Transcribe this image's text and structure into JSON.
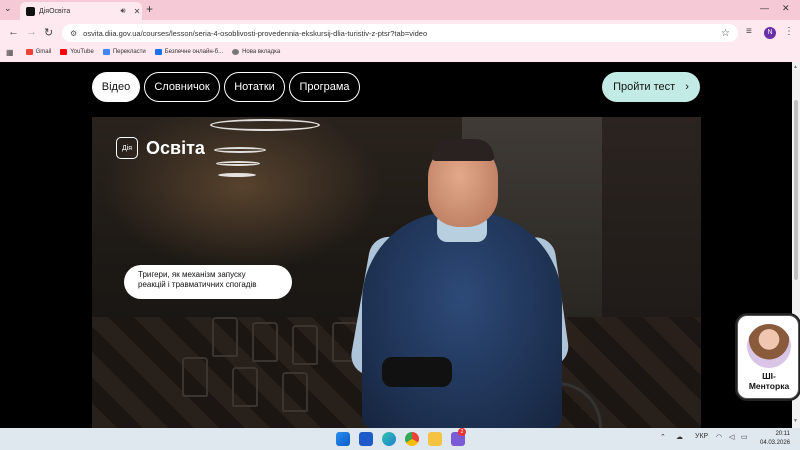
{
  "browser": {
    "tab_title": "ДіяОсвіта",
    "url": "osvita.diia.gov.ua/courses/lesson/seria-4-osoblivosti-provedennia-ekskursij-dlia-turistiv-z-ptsr?tab=video",
    "profile_initial": "N",
    "bookmarks": [
      "Gmail",
      "YouTube",
      "Перекласти",
      "Безпечне онлайн-б...",
      "Нова вкладка"
    ]
  },
  "page": {
    "tabs": [
      {
        "label": "Відео",
        "active": true
      },
      {
        "label": "Словничок",
        "active": false
      },
      {
        "label": "Нотатки",
        "active": false
      },
      {
        "label": "Програма",
        "active": false
      }
    ],
    "test_button": "Пройти тест",
    "video": {
      "logo_badge": "Дія",
      "logo_text": "Освіта",
      "caption_line1": "Тригери, як механізм запуску",
      "caption_line2": "реакцій і травматичних спогадів"
    },
    "mentor_label_line1": "ШІ-",
    "mentor_label_line2": "Менторка"
  },
  "taskbar": {
    "language": "УКР",
    "time": "20:11",
    "date": "04.03.2026",
    "notification_badge": "2"
  }
}
